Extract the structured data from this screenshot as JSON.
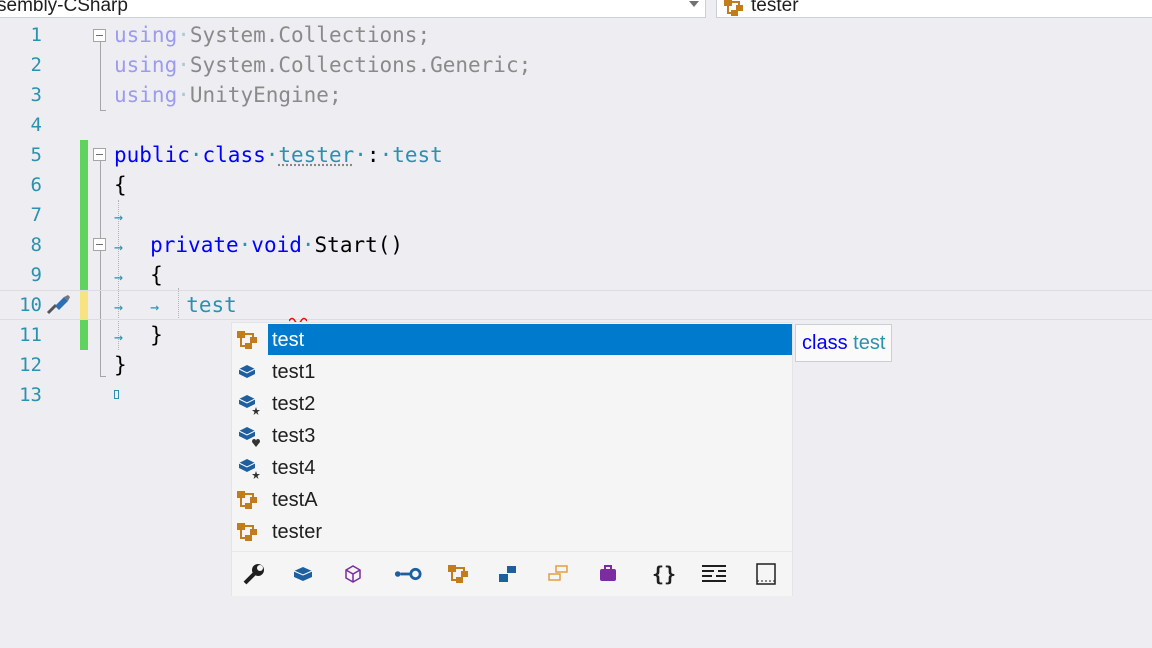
{
  "navbar": {
    "project": "sembly-CSharp",
    "member": "tester"
  },
  "lines": {
    "n1": "1",
    "n2": "2",
    "n3": "3",
    "n4": "4",
    "n5": "5",
    "n6": "6",
    "n7": "7",
    "n8": "8",
    "n9": "9",
    "n10": "10",
    "n11": "11",
    "n12": "12",
    "n13": "13"
  },
  "code": {
    "using": "using",
    "l1_ns": "System.Collections;",
    "l2_ns": "System.Collections.Generic;",
    "l3_ns": "UnityEngine;",
    "public": "public",
    "class": "class",
    "tester": "tester",
    "colon": ":",
    "test": "test",
    "open_brace": "{",
    "close_brace": "}",
    "private": "private",
    "void": "void",
    "start": "Start()",
    "typed": "test"
  },
  "completion": {
    "items": [
      {
        "label": "test",
        "icon": "class-icon",
        "selected": true
      },
      {
        "label": "test1",
        "icon": "field-icon"
      },
      {
        "label": "test2",
        "icon": "field-shortcut-icon"
      },
      {
        "label": "test3",
        "icon": "field-protected-icon"
      },
      {
        "label": "test4",
        "icon": "field-shortcut-icon"
      },
      {
        "label": "testA",
        "icon": "class-icon"
      },
      {
        "label": "tester",
        "icon": "class-icon"
      }
    ],
    "filters": [
      "wrench-icon",
      "field-filter-icon",
      "local-filter-icon",
      "property-filter-icon",
      "class-filter-icon",
      "struct-filter-icon",
      "interface-filter-icon",
      "enum-filter-icon",
      "namespace-filter-icon",
      "keyword-filter-icon",
      "snippet-filter-icon"
    ]
  },
  "tooltip": {
    "keyword": "class",
    "name": "test"
  },
  "colors": {
    "keyword": "#0000ff",
    "type": "#2b91af",
    "selection": "#007acc",
    "changebar_saved": "#5ed35e",
    "changebar_unsaved": "#f7e37f",
    "class_icon": "#c27d1a",
    "field_icon": "#1e5fa0"
  }
}
